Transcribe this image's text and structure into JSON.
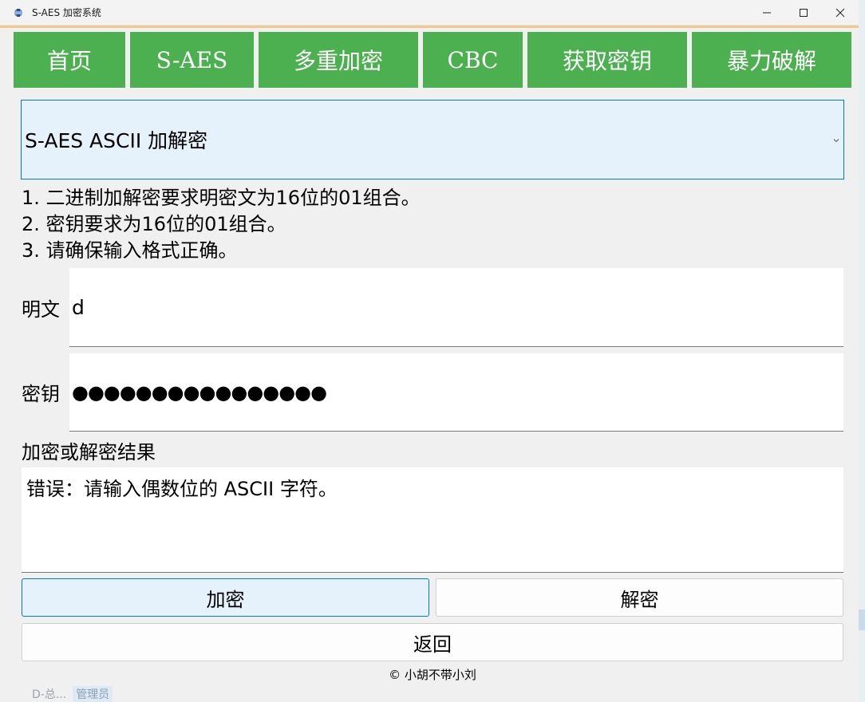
{
  "window": {
    "title": "S-AES 加密系统",
    "accent": "#4caf50",
    "select_border": "#0078d7"
  },
  "window_controls": {
    "minimize": "minimize-icon",
    "maximize": "maximize-icon",
    "close": "close-icon"
  },
  "tabs": [
    {
      "label": "首页"
    },
    {
      "label": "S-AES"
    },
    {
      "label": "多重加密"
    },
    {
      "label": "CBC"
    },
    {
      "label": "获取密钥"
    },
    {
      "label": "暴力破解"
    }
  ],
  "mode_select": {
    "selected": "S-AES ASCII 加解密"
  },
  "instructions": [
    "1. 二进制加解密要求明密文为16位的01组合。",
    "2. 密钥要求为16位的01组合。",
    "3. 请确保输入格式正确。"
  ],
  "plaintext": {
    "label": "明文",
    "value": "d"
  },
  "key": {
    "label": "密钥",
    "masked_value": "●●●●●●●●●●●●●●●●"
  },
  "result": {
    "label": "加密或解密结果",
    "value": "错误：请输入偶数位的 ASCII 字符。"
  },
  "buttons": {
    "encrypt": "加密",
    "decrypt": "解密",
    "back": "返回"
  },
  "footer": "© 小胡不带小刘",
  "taskbar_peek": {
    "item": "D-总...",
    "badge": "管理员"
  }
}
